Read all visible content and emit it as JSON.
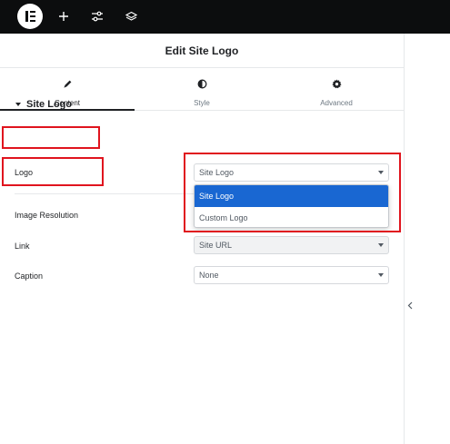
{
  "topbar": {
    "logo_icon": "elementor-logo-icon",
    "add_icon": "plus-icon",
    "settings_icon": "sliders-icon",
    "structure_icon": "layers-icon",
    "background": "#0c0d0e"
  },
  "panel": {
    "title": "Edit Site Logo"
  },
  "tabs": [
    {
      "label": "Content",
      "icon": "pencil-icon",
      "active": true
    },
    {
      "label": "Style",
      "icon": "half-circle-icon",
      "active": false
    },
    {
      "label": "Advanced",
      "icon": "gear-icon",
      "active": false
    }
  ],
  "section": {
    "title": "Site Logo"
  },
  "controls": {
    "logo": {
      "label": "Logo",
      "value": "Site Logo",
      "options": [
        "Site Logo",
        "Custom Logo"
      ],
      "highlighted_option": "Site Logo"
    },
    "image_resolution": {
      "label": "Image Resolution"
    },
    "link": {
      "label": "Link",
      "value": "Site URL"
    },
    "caption": {
      "label": "Caption",
      "value": "None"
    }
  },
  "colors": {
    "highlight_box": "#e0141e",
    "selected_option": "#1967d2"
  }
}
